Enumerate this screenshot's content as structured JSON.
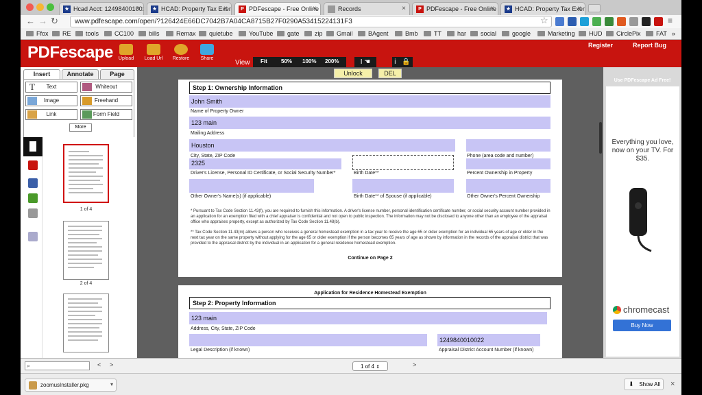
{
  "browser": {
    "tabs": [
      {
        "label": "Hcad Acct: 124984001002..."
      },
      {
        "label": "HCAD: Property Tax Exem..."
      },
      {
        "label": "PDFescape - Free Online P..."
      },
      {
        "label": "Records"
      },
      {
        "label": "PDFescape - Free Online P..."
      },
      {
        "label": "HCAD: Property Tax Exem..."
      }
    ],
    "url": "www.pdfescape.com/open/?126424E66DC7042B7A04CA8715B27F0290A53415224131F3",
    "bookmarks": [
      "Ffox",
      "RE",
      "tools",
      "CC100",
      "bills",
      "Remax",
      "quietube",
      "YouTube",
      "gate",
      "zip",
      "Gmail",
      "BAgent",
      "Bmb",
      "TT",
      "har",
      "social",
      "google",
      "Marketing",
      "HUD",
      "CirclePix",
      "FAT"
    ],
    "overflow": "»"
  },
  "app": {
    "logo": "PDFescape",
    "toolbar": [
      "Upload",
      "Load Url",
      "Restore",
      "Share"
    ],
    "view_label": "View",
    "zoom_options": [
      "Fit",
      "50%",
      "100%",
      "200%"
    ],
    "register": "Register",
    "report_bug": "Report Bug"
  },
  "left": {
    "tabs": [
      "Insert",
      "Annotate",
      "Page"
    ],
    "tools": [
      "Text",
      "Whiteout",
      "Image",
      "Freehand",
      "Link",
      "Form Field"
    ],
    "more": "More",
    "thumb_labels": [
      "1 of 4",
      "2 of 4"
    ]
  },
  "doc": {
    "unlock": "Unlock",
    "del": "DEL",
    "step1": "Step 1:  Ownership Information",
    "owner_name_value": "John Smith",
    "owner_name_label": "Name of Property Owner",
    "mailing_value": "123 main",
    "mailing_label": "Mailing Address",
    "city_value": "Houston",
    "city_label": "City, State, ZIP Code",
    "phone_label": "Phone (area code and number)",
    "dl_value": "2325",
    "dl_label": "Driver's License, Personal ID Certificate, or Social Security Number*",
    "birth_label": "Birth Date**",
    "percent_label": "Percent Ownership in Property",
    "other_owner_label": "Other Owner's Name(s) (if applicable)",
    "spouse_birth_label": "Birth Date** of Spouse (if applicable)",
    "other_percent_label": "Other Owner's Percent Ownership",
    "footnote1": "*    Pursuant to Tax Code Section 11.43(f), you are required to furnish this information. A driver's license number, personal identification certificate number, or social security account number provided in an application for an exemption filed with a chief appraiser is confidential and not open to public inspection. The information may not be disclosed to anyone other than an employee of the appraisal office who appraises property, except as authorized by Tax Code Section 11.48(b).",
    "footnote2": "**   Tax Code Section 11.43(m) allows a person who receives a general homestead exemption in a tax year to receive the age 65 or older exemption for an individual 65 years of age or older in the next tax year on the same property without applying for the age 65 or older exemption if the person becomes 65 years of age as shown by information in the records of the appraisal district that was provided to the appraisal district by the individual in an application for a general residence homestead exemption.",
    "continue": "Continue on Page 2",
    "page2_title": "Application for Residence Homestead Exemption",
    "step2": "Step 2:  Property Information",
    "address_value": "123 main",
    "address_label": "Address, City, State, ZIP Code",
    "account_value": "1249840010022",
    "legal_label": "Legal Description (if known)",
    "account_label": "Appraisal District Account Number (if known)"
  },
  "ad": {
    "header": "Use PDFescape Ad Free!",
    "text": "Everything you love, now on your TV. For $35.",
    "brand": "chromecast",
    "button": "Buy Now"
  },
  "bottom": {
    "prev": "<",
    "next": ">",
    "page_indicator": "1 of 4",
    "page_next": ">"
  },
  "shelf": {
    "file": "zoomusInstaller.pkg",
    "show_all": "Show All"
  }
}
